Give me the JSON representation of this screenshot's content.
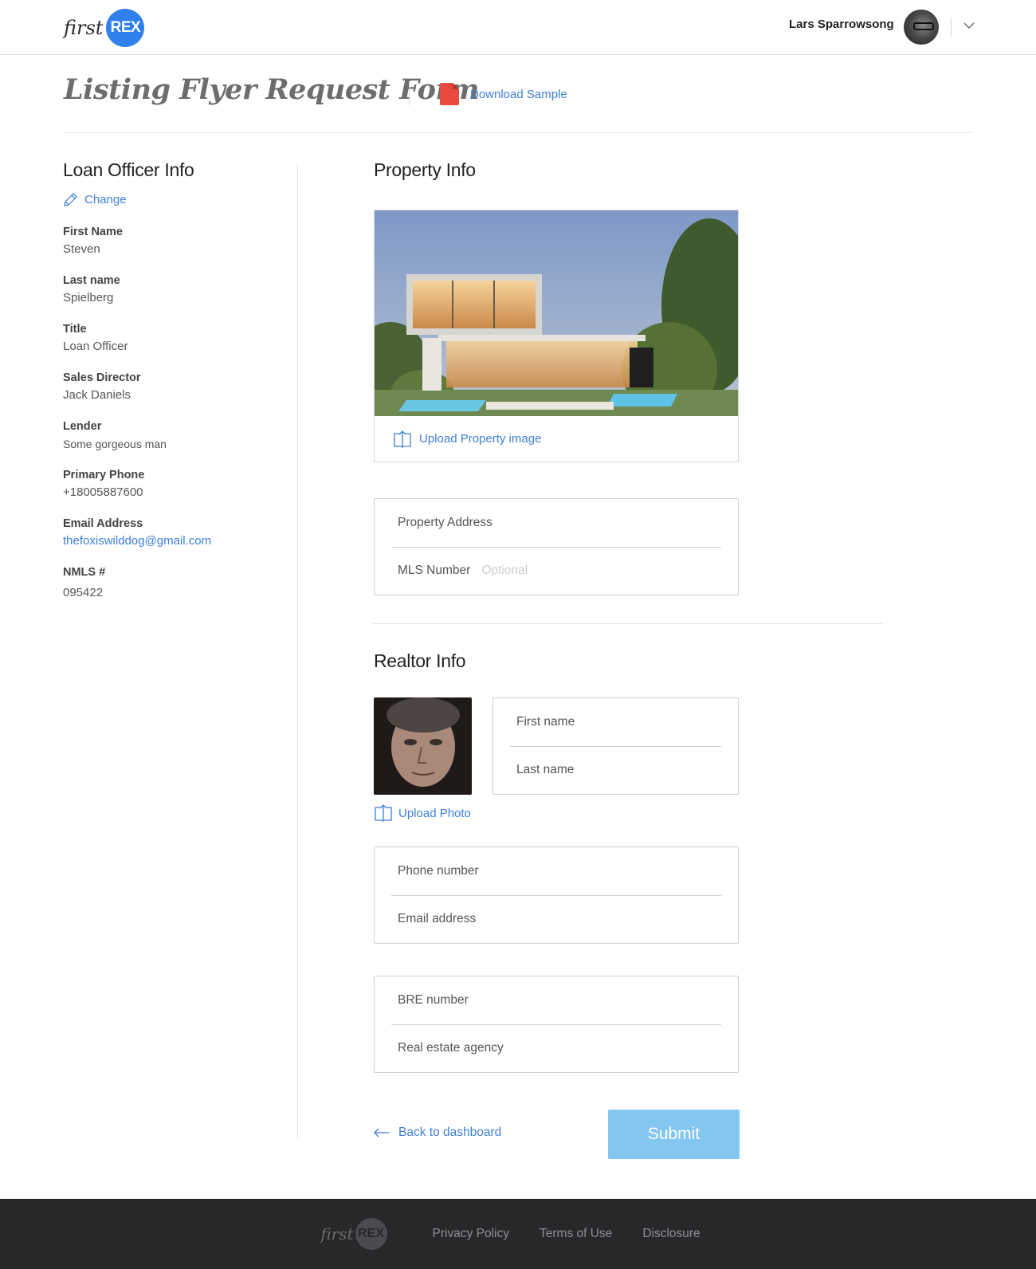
{
  "header": {
    "logo_first": "first",
    "logo_rex": "REX",
    "user_name": "Lars Sparrowsong"
  },
  "page": {
    "title": "Listing Flyer Request Form",
    "download_label": "Download Sample"
  },
  "loan_officer": {
    "heading": "Loan Officer Info",
    "change_label": "Change",
    "fields": [
      {
        "label": "First Name",
        "value": "Steven"
      },
      {
        "label": "Last name",
        "value": "Spielberg"
      },
      {
        "label": "Title",
        "value": "Loan Officer"
      },
      {
        "label": "Sales Director",
        "value": "Jack Daniels"
      },
      {
        "label": "Lender",
        "value": "Some gorgeous man"
      },
      {
        "label": "Primary Phone",
        "value": "+18005887600"
      },
      {
        "label": "Email Address",
        "value": "thefoxiswilddog@gmail.com"
      },
      {
        "label": "NMLS #",
        "value": "095422"
      }
    ]
  },
  "property": {
    "heading": "Property Info",
    "upload_label": "Upload Property image",
    "address_placeholder": "Property Address",
    "mls_label": "MLS Number",
    "mls_hint": "Optional"
  },
  "realtor": {
    "heading": "Realtor Info",
    "upload_photo_label": "Upload Photo",
    "first_name": "First name",
    "last_name": "Last name",
    "phone": "Phone number",
    "email": "Email address",
    "bre": "BRE number",
    "agency": "Real estate agency"
  },
  "actions": {
    "back_label": "Back to dashboard",
    "submit_label": "Submit"
  },
  "footer": {
    "logo_first": "first",
    "logo_rex": "REX",
    "links": [
      "Privacy Policy",
      "Terms of Use",
      "Disclosure"
    ]
  },
  "colors": {
    "accent": "#3f7fd8",
    "brand": "#2f80ed",
    "submit": "#83c6ef",
    "footer_bg": "#27282a"
  }
}
